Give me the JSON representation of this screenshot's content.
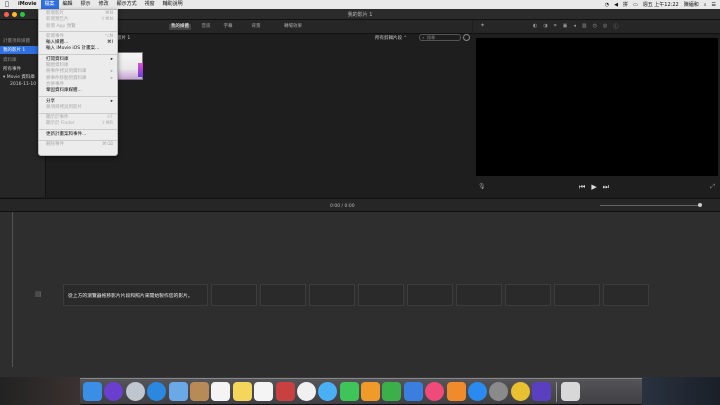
{
  "menubar": {
    "apple": "",
    "items": [
      "iMovie",
      "檔案",
      "編輯",
      "標示",
      "修改",
      "顯示方式",
      "視窗",
      "輔助說明"
    ],
    "active_index": 1,
    "clock": "週五 上午12:22",
    "user": "陳緬和"
  },
  "window": {
    "title": "我的影片 1"
  },
  "sidebar": {
    "header": "計畫項目媒體",
    "project_item": "我的影片 1",
    "library_header": "資料庫",
    "items": [
      "所有事件",
      "▾ Movie 資料庫",
      "2016-11-10"
    ]
  },
  "browser": {
    "tabs": [
      "我的媒體",
      "音訊",
      "字幕",
      "背景",
      "轉場效果"
    ],
    "selected_tab": 0,
    "library_title": "影片 1",
    "filter_label": "所有剪輯片段 ⌃",
    "search_placeholder": "搜尋"
  },
  "viewer": {
    "controls": [
      "⏮",
      "▶",
      "⏭"
    ]
  },
  "timeline": {
    "time": "0:00 / 0:00",
    "message": "從上方的瀏覽器拖移影片片段和照片來開始製作您的影片。"
  },
  "file_menu": {
    "items": [
      {
        "label": "新增影片",
        "shortcut": "⌘N",
        "enabled": false
      },
      {
        "label": "新增預告片",
        "shortcut": "⇧⌘N",
        "enabled": false
      },
      {
        "label": "新增 App 預覽",
        "shortcut": "",
        "enabled": false
      },
      {
        "sep": true
      },
      {
        "label": "新增事件",
        "shortcut": "⌥N",
        "enabled": false
      },
      {
        "label": "輸入媒體...",
        "shortcut": "⌘I",
        "enabled": true
      },
      {
        "label": "輸入 iMovie iOS 計畫案...",
        "shortcut": "",
        "enabled": true
      },
      {
        "sep": true
      },
      {
        "label": "打開資料庫",
        "shortcut": "",
        "enabled": true,
        "submenu": true
      },
      {
        "label": "關閉資料庫",
        "shortcut": "",
        "enabled": false
      },
      {
        "label": "將事件拷貝到資料庫",
        "shortcut": "",
        "enabled": false,
        "submenu": true
      },
      {
        "label": "將事件移動到資料庫",
        "shortcut": "",
        "enabled": false,
        "submenu": true
      },
      {
        "label": "合併事件",
        "shortcut": "",
        "enabled": false
      },
      {
        "label": "鞏固資料庫媒體...",
        "shortcut": "",
        "enabled": true
      },
      {
        "sep": true
      },
      {
        "label": "分享",
        "shortcut": "",
        "enabled": true,
        "submenu": true
      },
      {
        "label": "將項目拷貝到影片",
        "shortcut": "",
        "enabled": false
      },
      {
        "sep": true
      },
      {
        "label": "顯示於事件",
        "shortcut": "⇧F",
        "enabled": false
      },
      {
        "label": "顯示於 Finder",
        "shortcut": "⇧⌘R",
        "enabled": false
      },
      {
        "sep": true
      },
      {
        "label": "更新計畫案和事件...",
        "shortcut": "",
        "enabled": true
      },
      {
        "sep": true
      },
      {
        "label": "刪除事件",
        "shortcut": "⌘⌫",
        "enabled": false
      }
    ]
  },
  "colors": {
    "accent": "#2f6fe0",
    "close": "#fc5f57",
    "minimize": "#fdbc2e",
    "zoom": "#28c840"
  },
  "dock": {
    "icons": [
      {
        "name": "finder-icon",
        "color": "#3a8ee6"
      },
      {
        "name": "siri-icon",
        "color": "#6a3fd0"
      },
      {
        "name": "launchpad-icon",
        "color": "#bfc6d0"
      },
      {
        "name": "safari-icon",
        "color": "#2a88e0"
      },
      {
        "name": "mail-icon",
        "color": "#6aa8e8"
      },
      {
        "name": "contacts-icon",
        "color": "#b88a55"
      },
      {
        "name": "calendar-icon",
        "color": "#f4f4f4"
      },
      {
        "name": "notes-icon",
        "color": "#f6d65a"
      },
      {
        "name": "reminders-icon",
        "color": "#f4f4f4"
      },
      {
        "name": "photo-booth-icon",
        "color": "#c94040"
      },
      {
        "name": "photos-icon",
        "color": "#f0f0f0"
      },
      {
        "name": "messages-icon",
        "color": "#4ab0f5"
      },
      {
        "name": "facetime-icon",
        "color": "#3fc45a"
      },
      {
        "name": "pages-icon",
        "color": "#f09a2a"
      },
      {
        "name": "numbers-icon",
        "color": "#3aaf4a"
      },
      {
        "name": "keynote-icon",
        "color": "#3a7ee0"
      },
      {
        "name": "itunes-icon",
        "color": "#f04a7a"
      },
      {
        "name": "ibooks-icon",
        "color": "#f08a2a"
      },
      {
        "name": "app-store-icon",
        "color": "#2a8af0"
      },
      {
        "name": "system-preferences-icon",
        "color": "#8a8a8a"
      },
      {
        "name": "chrome-icon",
        "color": "#e8c030"
      },
      {
        "name": "imovie-icon",
        "color": "#5a3fc0"
      },
      {
        "name": "trash-icon",
        "color": "#d8d8d8"
      }
    ]
  }
}
